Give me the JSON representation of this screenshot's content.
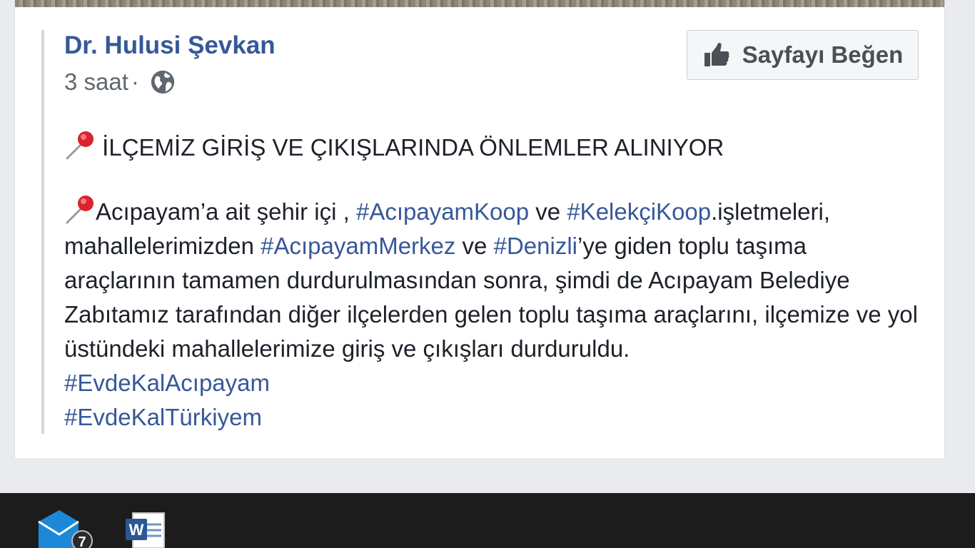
{
  "post": {
    "author": "Dr. Hulusi Şevkan",
    "time": "3 saat",
    "separator": "·",
    "audience_icon": "globe-icon",
    "like_page_label": "Sayfayı Beğen",
    "headline": " İLÇEMİZ GİRİŞ VE ÇIKIŞLARINDA ÖNLEMLER ALINIYOR",
    "pin_icon": "pushpin-icon",
    "body": {
      "l1_a": "Acıpayam’a ait şehir içi , ",
      "l1_tag1": "#AcıpayamKoop",
      "l1_b": " ve ",
      "l1_tag2": "#KelekçiKoop",
      "l1_c": ".işletmeleri,",
      "l2_a": "mahallelerimizden ",
      "l2_tag1": "#AcıpayamMerkez",
      "l2_b": " ve ",
      "l2_tag2": "#Denizli",
      "l2_c": "’ye giden toplu taşıma",
      "l3": "araçlarının tamamen durdurulmasından sonra, şimdi de Acıpayam Belediye",
      "l4": "Zabıtamız tarafından diğer ilçelerden gelen toplu taşıma araçlarını, ilçemize ve yol",
      "l5": "üstündeki mahallelerimize giriş ve çıkışları durduruldu.",
      "tag_a": "#EvdeKalAcıpayam",
      "tag_b": "#EvdeKalTürkiyem"
    },
    "colors": {
      "link": "#365899",
      "text": "#1d2129",
      "meta": "#616770"
    }
  },
  "taskbar": {
    "mail_badge": "7",
    "icons": [
      "mail-icon",
      "word-icon"
    ],
    "word_glyph": "W"
  }
}
